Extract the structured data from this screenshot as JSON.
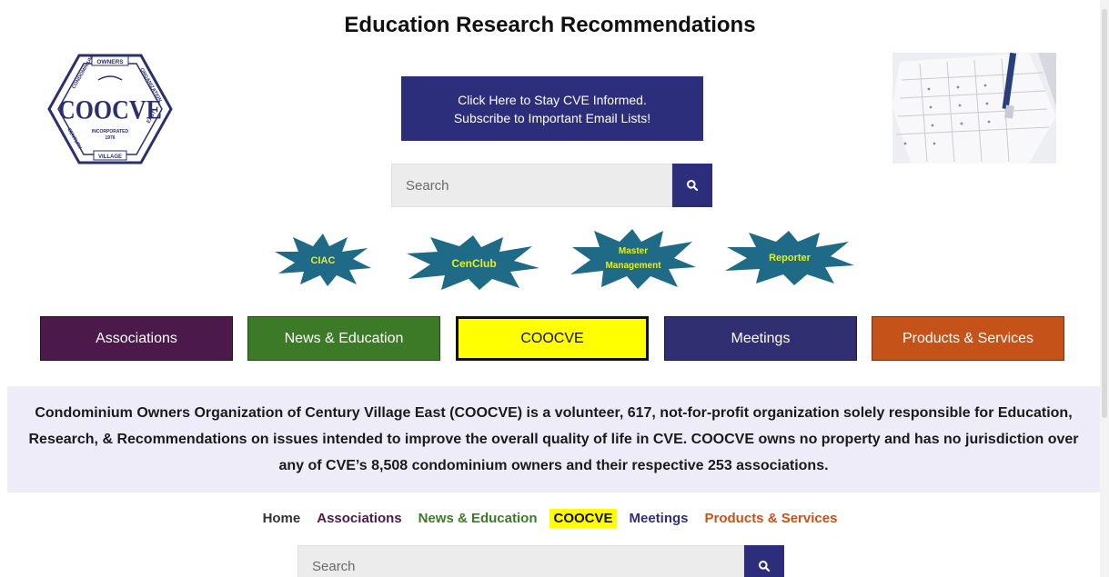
{
  "header": {
    "title_parts": [
      {
        "initial": "E",
        "rest": "ducation "
      },
      {
        "initial": "R",
        "rest": "esearch "
      },
      {
        "initial": "R",
        "rest": "ecommendations"
      }
    ]
  },
  "logo": {
    "top": "OWNERS",
    "left": "CONDOMINIUM",
    "right": "ORGANIZATION",
    "center": "COOCVE",
    "sub1": "INCORPORATED",
    "sub2": "1976",
    "bottom_left": "CENTURY",
    "bottom_right": "EAST",
    "bottom": "VILLAGE"
  },
  "banner": {
    "line1": "Click Here to Stay CVE Informed.",
    "line2": "Subscribe to Important Email Lists!"
  },
  "search_top": {
    "placeholder": "Search"
  },
  "search_bottom": {
    "placeholder": "Search"
  },
  "stars": [
    {
      "label": "CIAC"
    },
    {
      "label": "CenClub"
    },
    {
      "label1": "Master",
      "label2": "Management"
    },
    {
      "label": "Reporter"
    }
  ],
  "nav_buttons": [
    {
      "label": "Associations"
    },
    {
      "label": "News & Education"
    },
    {
      "label": "COOCVE"
    },
    {
      "label": "Meetings"
    },
    {
      "label": "Products & Services"
    }
  ],
  "mission": {
    "text": "Condominium Owners Organization of Century Village East (COOCVE) is a volunteer, 617, not-for-profit organization solely responsible for Education, Research, & Recommendations on issues intended to improve the overall quality of life in CVE. COOCVE owns no property and has no jurisdiction over any of CVE’s 8,508 condominium owners and their respective 253 associations."
  },
  "text_nav": [
    {
      "label": "Home"
    },
    {
      "label": "Associations"
    },
    {
      "label": "News & Education"
    },
    {
      "label": "COOCVE"
    },
    {
      "label": "Meetings"
    },
    {
      "label": "Products & Services"
    }
  ],
  "colors": {
    "banner": "#2c2e7c",
    "associations": "#4b1a4b",
    "news": "#3c7a28",
    "coocve": "#ffff00",
    "meetings": "#2f2f72",
    "products": "#c55218",
    "star_fill": "#1f6a86",
    "star_text": "#e6f01e"
  }
}
